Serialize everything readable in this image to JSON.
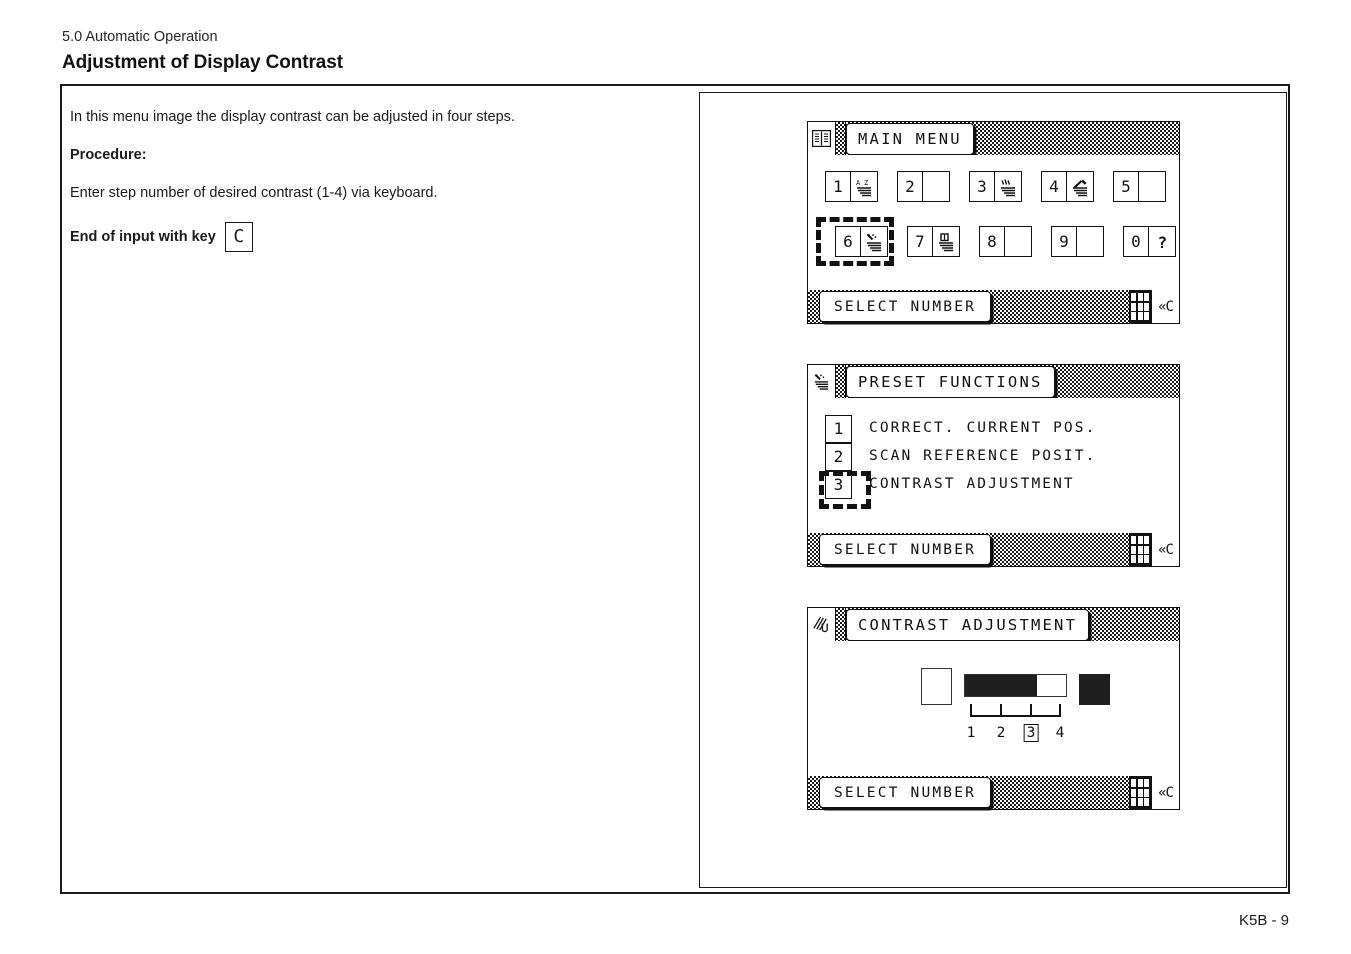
{
  "header": {
    "section": "5.0 Automatic Operation",
    "title": "Adjustment of Display Contrast"
  },
  "body_text": {
    "intro": "In this menu image the display contrast can be adjusted in four steps.",
    "procedure_label": "Procedure",
    "procedure_colon": ":",
    "step": "Enter step number of desired contrast (1-4) via keyboard.",
    "end_of_input": "End of input with key",
    "end_key_glyph": "C"
  },
  "screens": {
    "main_menu": {
      "title": "MAIN MENU",
      "title_icon": "book-icon",
      "status": "SELECT NUMBER",
      "back_key": "«C",
      "row1": [
        {
          "num": "1",
          "icon": "az-document-icon"
        },
        {
          "num": "2",
          "icon": ""
        },
        {
          "num": "3",
          "icon": "marked-document-icon"
        },
        {
          "num": "4",
          "icon": "wrench-tool-icon"
        },
        {
          "num": "5",
          "icon": ""
        }
      ],
      "row2": [
        {
          "num": "6",
          "icon": "preset-functions-icon"
        },
        {
          "num": "7",
          "icon": "setup-document-icon"
        },
        {
          "num": "8",
          "icon": ""
        },
        {
          "num": "9",
          "icon": ""
        },
        {
          "num": "0",
          "icon": "question-mark-icon"
        }
      ],
      "selected_button": "6"
    },
    "preset_functions": {
      "title": "PRESET FUNCTIONS",
      "title_icon": "preset-functions-icon",
      "status": "SELECT NUMBER",
      "back_key": "«C",
      "items": [
        {
          "num": "1",
          "label": "CORRECT. CURRENT POS."
        },
        {
          "num": "2",
          "label": "SCAN REFERENCE POSIT."
        },
        {
          "num": "3",
          "label": "CONTRAST ADJUSTMENT"
        }
      ],
      "selected_item": "3"
    },
    "contrast_adjustment": {
      "title": "CONTRAST ADJUSTMENT",
      "title_icon": "contrast-hatch-icon",
      "status": "SELECT NUMBER",
      "back_key": "«C",
      "scale_labels": [
        "1",
        "2",
        "3",
        "4"
      ],
      "selected_step": "3",
      "fill_percent": 71
    }
  },
  "footer": {
    "page_number": "K5B - 9"
  }
}
